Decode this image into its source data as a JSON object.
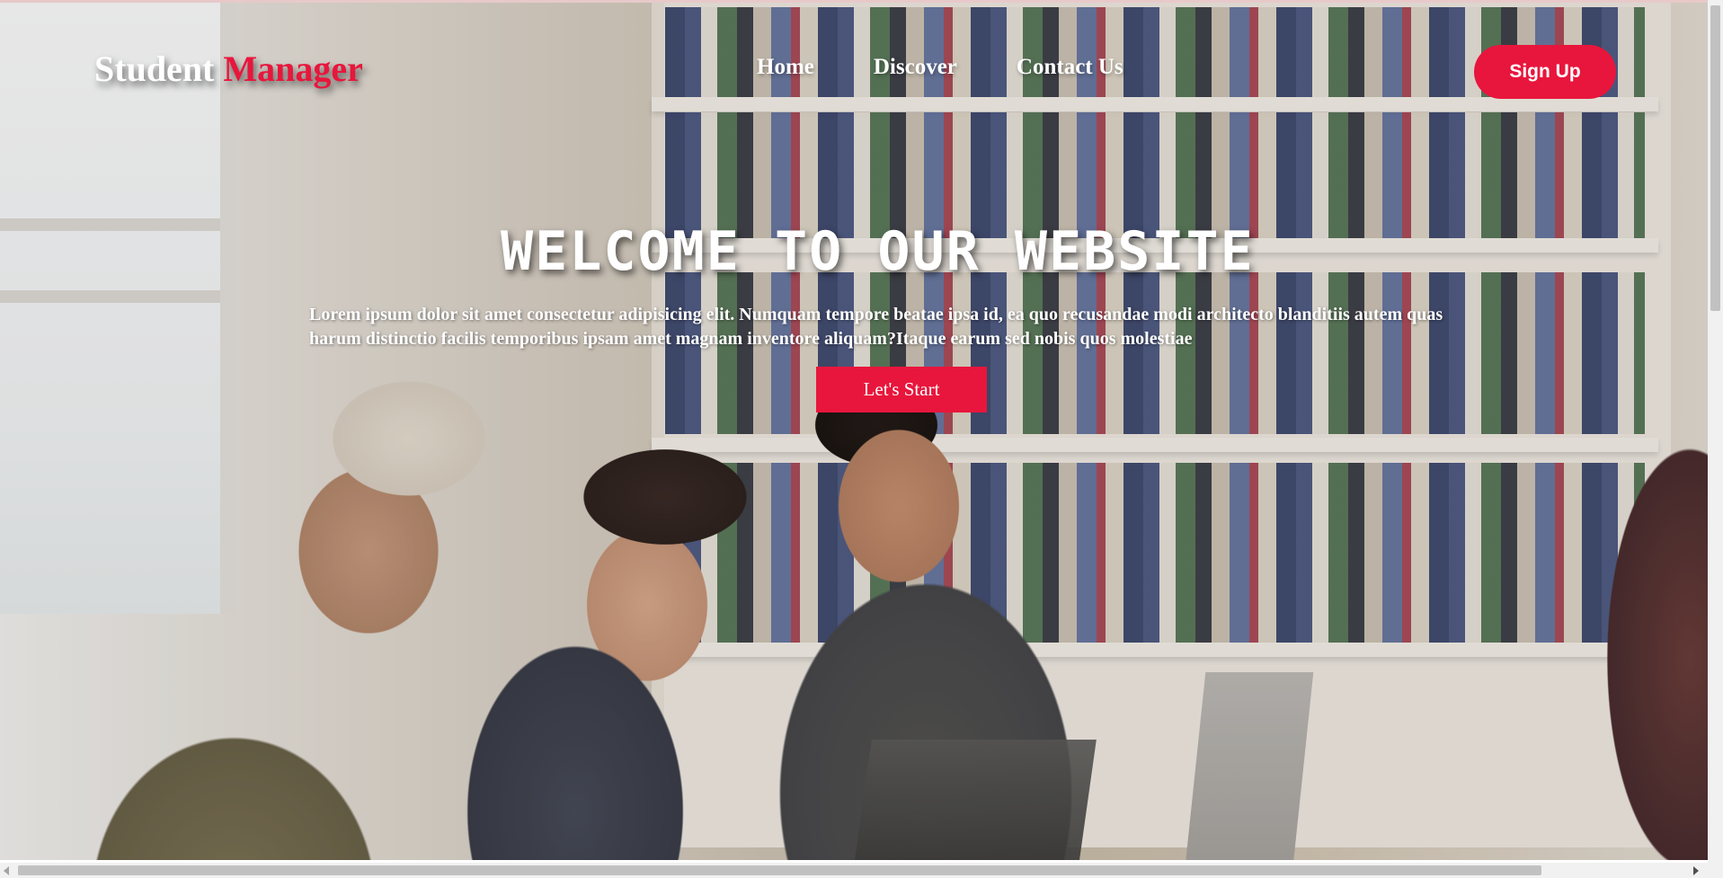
{
  "header": {
    "logo_part1": "Student ",
    "logo_part2": "Manager",
    "nav": [
      "Home",
      "Discover",
      "Contact Us"
    ],
    "signup_label": "Sign Up"
  },
  "hero": {
    "title": "WELCOME TO OUR WEBSITE",
    "text": "Lorem ipsum dolor sit amet consectetur adipisicing elit. Numquam tempore beatae ipsa id, ea quo recusandae modi architecto blanditiis autem quas harum distinctio facilis temporibus ipsam amet magnam inventore aliquam?Itaque earum sed nobis quos molestiae",
    "button_label": "Let's Start"
  },
  "colors": {
    "accent": "#e8163c",
    "text": "#ffffff"
  }
}
